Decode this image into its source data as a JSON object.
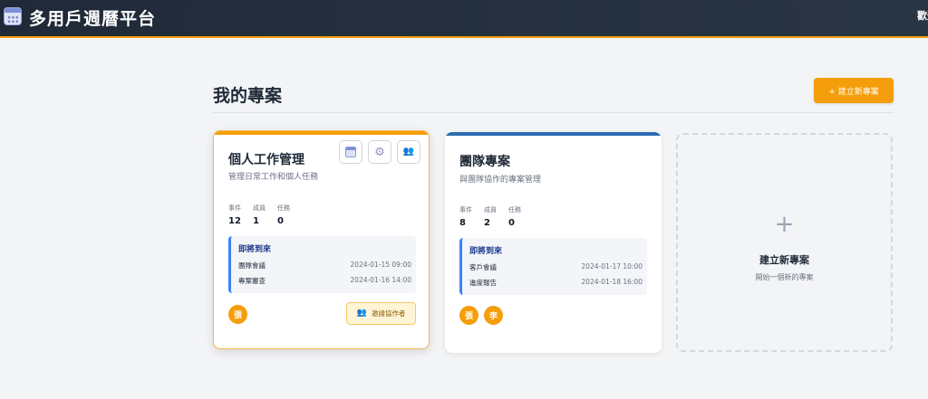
{
  "app": {
    "title": "多用戶週曆平台",
    "user_label": "歡迎",
    "logo_icon": "calendar-icon"
  },
  "header": {
    "title": "我的專案",
    "create_button": "+ 建立新專案"
  },
  "colors": {
    "topbar": "#1f2937",
    "accent": "#f59e0b",
    "blue": "#2b6cb0"
  },
  "projects": [
    {
      "name": "個人工作管理",
      "description": "管理日常工作和個人任務",
      "stats": [
        {
          "label": "事件",
          "value": "12"
        },
        {
          "label": "成員",
          "value": "1"
        },
        {
          "label": "任務",
          "value": "0"
        }
      ],
      "upcoming_title": "即將到來",
      "events": [
        {
          "name": "團隊會議",
          "date": "2024-01-15 09:00"
        },
        {
          "name": "專案審查",
          "date": "2024-01-16 14:00"
        }
      ],
      "members": [
        "張"
      ],
      "invite_label": "邀請協作者",
      "actions": [
        "calendar-icon",
        "gear-icon",
        "users-icon"
      ]
    },
    {
      "name": "團隊專案",
      "description": "與團隊協作的專案管理",
      "stats": [
        {
          "label": "事件",
          "value": "8"
        },
        {
          "label": "成員",
          "value": "2"
        },
        {
          "label": "任務",
          "value": "0"
        }
      ],
      "upcoming_title": "即將到來",
      "events": [
        {
          "name": "客戶會議",
          "date": "2024-01-17 10:00"
        },
        {
          "name": "進度報告",
          "date": "2024-01-18 16:00"
        }
      ],
      "members": [
        "張",
        "李"
      ]
    }
  ],
  "new_project": {
    "plus": "+",
    "title": "建立新專案",
    "description": "開始一個新的專案"
  }
}
